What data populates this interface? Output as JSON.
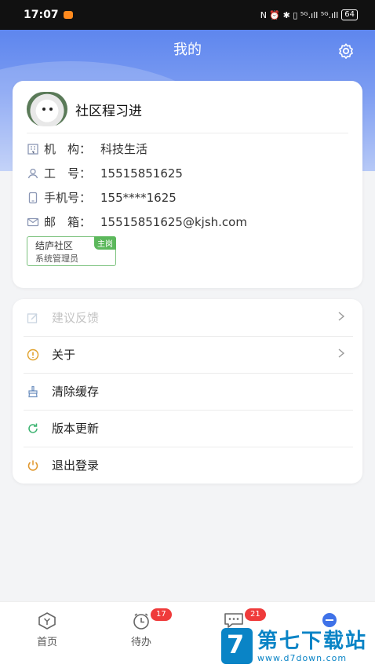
{
  "status_bar": {
    "time": "17:07",
    "indicators": "N ⏰ ✱ ▯ ⁵ᴳ.ıll ⁵ᴳ.ıll",
    "battery": "64"
  },
  "header": {
    "title": "我的"
  },
  "profile": {
    "name": "社区程习进",
    "fields": [
      {
        "label": "机　构：",
        "value": "科技生活"
      },
      {
        "label": "工　号：",
        "value": "15515851625"
      },
      {
        "label": "手机号：",
        "value": "155****1625"
      },
      {
        "label": "邮　箱：",
        "value": "15515851625@kjsh.com"
      }
    ],
    "tag": {
      "title": "结庐社区",
      "role": "系统管理员",
      "badge": "主岗"
    }
  },
  "menu": [
    {
      "label": "建议反馈",
      "icon": "edit-icon",
      "disabled": true
    },
    {
      "label": "关于",
      "icon": "info-icon"
    },
    {
      "label": "清除缓存",
      "icon": "broom-icon"
    },
    {
      "label": "版本更新",
      "icon": "refresh-icon"
    },
    {
      "label": "退出登录",
      "icon": "power-icon"
    }
  ],
  "tabs": [
    {
      "label": "首页"
    },
    {
      "label": "待办",
      "badge": "17"
    },
    {
      "label": "",
      "badge": "21"
    },
    {
      "label": ""
    }
  ],
  "watermark": {
    "title": "第七下载站",
    "url": "www.d7down.com",
    "logo": "7"
  },
  "colors": {
    "accent": "#5e86ee",
    "badge_red": "#ef3b3b",
    "tag_green": "#5cb85c"
  }
}
